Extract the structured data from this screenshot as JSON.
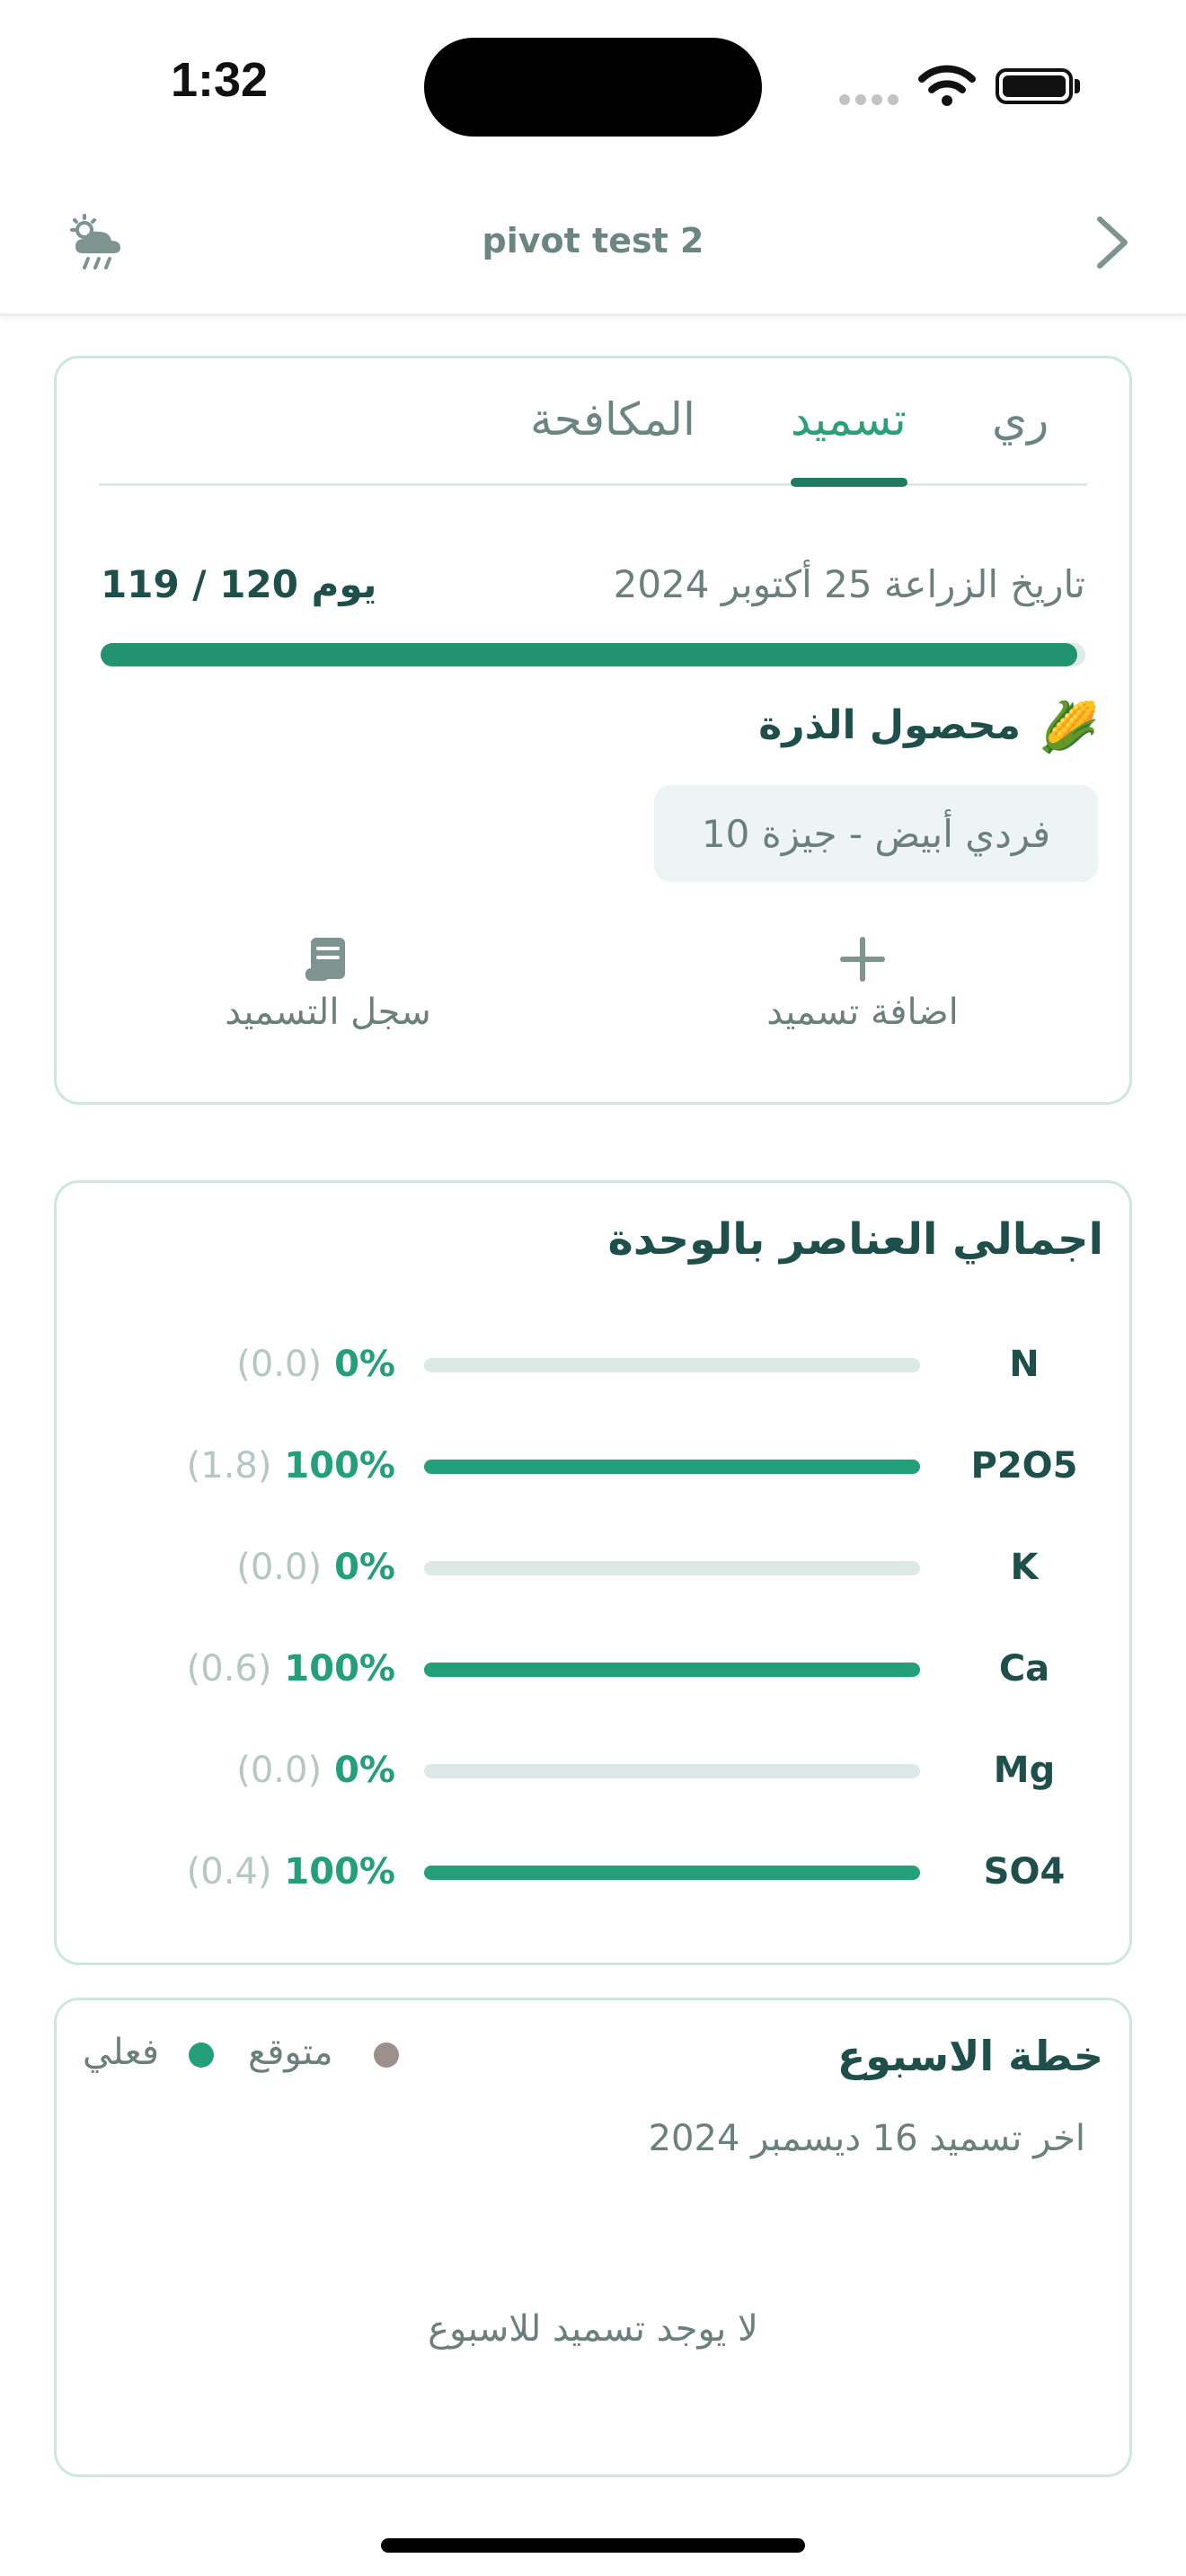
{
  "status_bar": {
    "time": "1:32"
  },
  "header": {
    "title": "pivot test 2",
    "left_icon": "weather-cloud-rain-icon",
    "right_icon": "chevron-right-icon"
  },
  "tabs": [
    {
      "label": "ري",
      "active": false
    },
    {
      "label": "تسميد",
      "active": true
    },
    {
      "label": "المكافحة",
      "active": false
    }
  ],
  "crop_card": {
    "planting_date": "تاريخ الزراعة 25 أكتوبر 2024",
    "days": "119 / 120 يوم",
    "progress": 0.9917,
    "crop_emoji": "🌽",
    "crop_name": "محصول الذرة",
    "variety": "فردي أبيض  -  جيزة 10",
    "add_fertilization": "اضافة تسميد",
    "fertilization_log": "سجل التسميد"
  },
  "nutrients": {
    "title": "اجمالي العناصر بالوحدة",
    "items": [
      {
        "name": "N",
        "percent": "0%",
        "raw": "(0.0)",
        "fill": 0
      },
      {
        "name": "P2O5",
        "percent": "100%",
        "raw": "(1.8)",
        "fill": 1
      },
      {
        "name": "K",
        "percent": "0%",
        "raw": "(0.0)",
        "fill": 0
      },
      {
        "name": "Ca",
        "percent": "100%",
        "raw": "(0.6)",
        "fill": 1
      },
      {
        "name": "Mg",
        "percent": "0%",
        "raw": "(0.0)",
        "fill": 0
      },
      {
        "name": "SO4",
        "percent": "100%",
        "raw": "(0.4)",
        "fill": 1
      }
    ]
  },
  "week_plan": {
    "title": "خطة الاسبوع",
    "legend_expected": "متوقع",
    "legend_actual": "فعلي",
    "last_fertilization": "اخر تسميد 16 ديسمبر 2024",
    "empty_message": "لا يوجد تسميد للاسبوع"
  },
  "colors": {
    "accent": "#22936f",
    "text_dark": "#1f4f4a",
    "muted": "#6b7f7b"
  }
}
